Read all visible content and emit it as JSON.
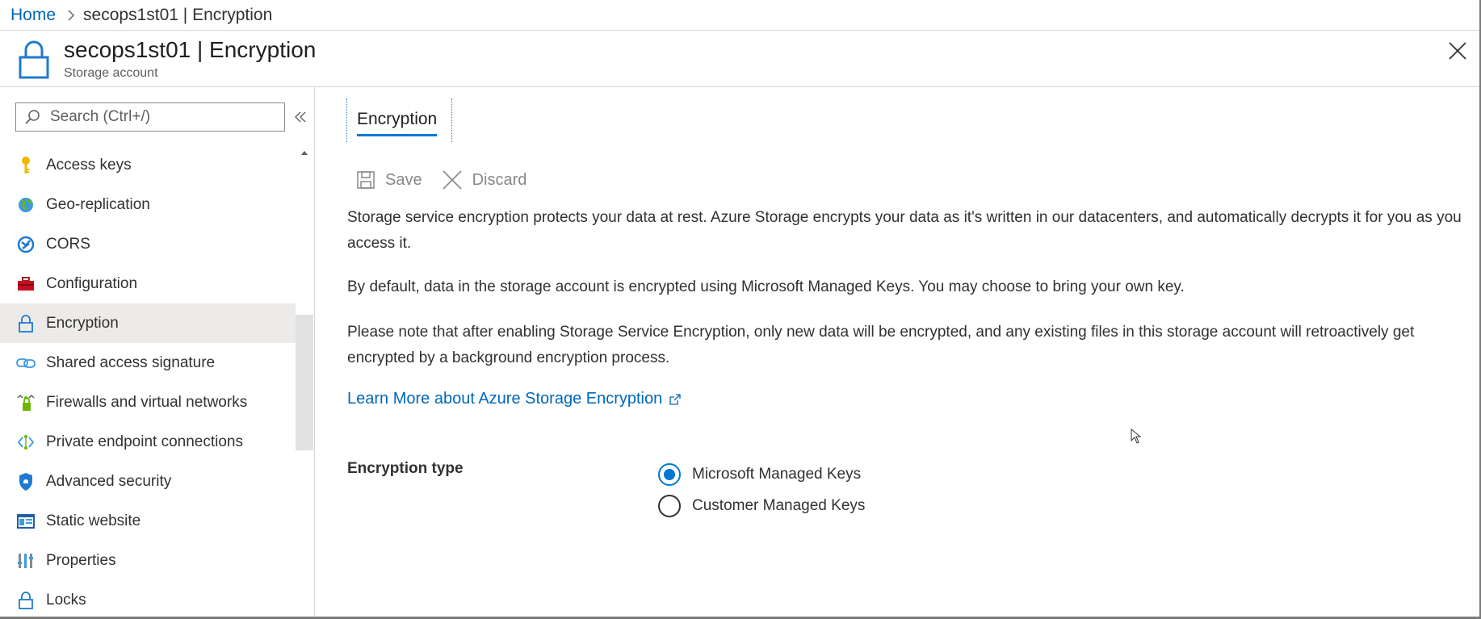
{
  "breadcrumb": {
    "home": "Home",
    "current": "secops1st01 | Encryption"
  },
  "header": {
    "title": "secops1st01 | Encryption",
    "subtitle": "Storage account",
    "icon": "lock-icon"
  },
  "sidebar": {
    "search_placeholder": "Search (Ctrl+/)",
    "items": [
      {
        "label": "Access keys",
        "icon": "key-icon"
      },
      {
        "label": "Geo-replication",
        "icon": "globe-icon"
      },
      {
        "label": "CORS",
        "icon": "cors-icon"
      },
      {
        "label": "Configuration",
        "icon": "toolbox-icon"
      },
      {
        "label": "Encryption",
        "icon": "lock-icon",
        "active": true
      },
      {
        "label": "Shared access signature",
        "icon": "link-icon"
      },
      {
        "label": "Firewalls and virtual networks",
        "icon": "firewall-icon"
      },
      {
        "label": "Private endpoint connections",
        "icon": "endpoint-icon"
      },
      {
        "label": "Advanced security",
        "icon": "shield-icon"
      },
      {
        "label": "Static website",
        "icon": "website-icon"
      },
      {
        "label": "Properties",
        "icon": "properties-icon"
      },
      {
        "label": "Locks",
        "icon": "lock-icon"
      }
    ]
  },
  "main": {
    "tab": "Encryption",
    "toolbar": {
      "save": "Save",
      "discard": "Discard"
    },
    "paragraphs": [
      "Storage service encryption protects your data at rest. Azure Storage encrypts your data as it's written in our datacenters, and automatically decrypts it for you as you access it.",
      "By default, data in the storage account is encrypted using Microsoft Managed Keys. You may choose to bring your own key.",
      "Please note that after enabling Storage Service Encryption, only new data will be encrypted, and any existing files in this storage account will retroactively get encrypted by a background encryption process."
    ],
    "learn_more": "Learn More about Azure Storage Encryption",
    "encryption_type_label": "Encryption type",
    "options": [
      {
        "label": "Microsoft Managed Keys",
        "selected": true
      },
      {
        "label": "Customer Managed Keys",
        "selected": false
      }
    ]
  },
  "colors": {
    "accent": "#0078d4",
    "link": "#0067b8",
    "active_row": "#edebe9"
  }
}
